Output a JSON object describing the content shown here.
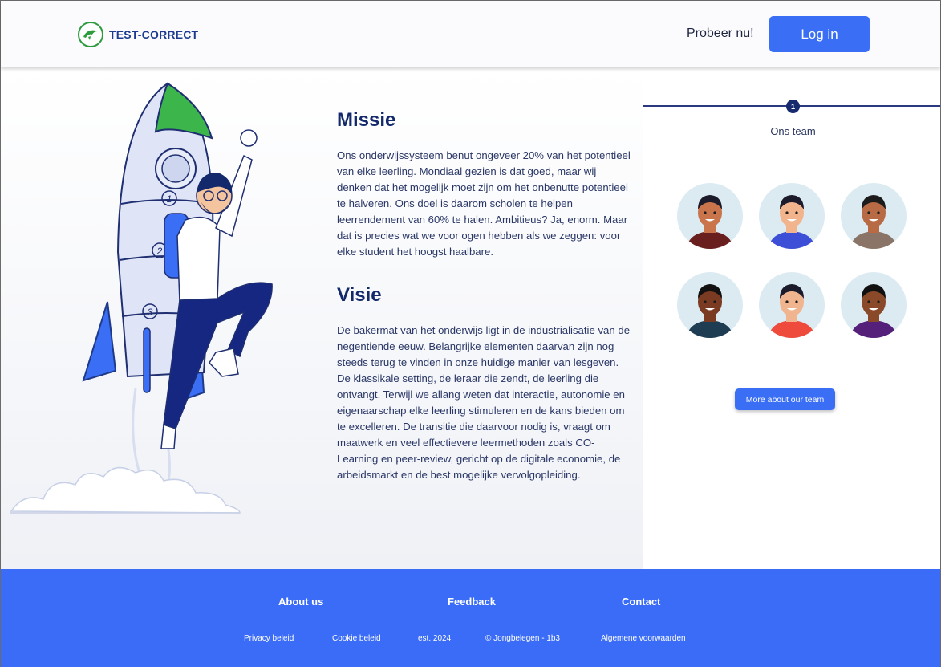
{
  "header": {
    "logo_text": "TEST-CORRECT",
    "try_label": "Probeer nu!",
    "login_label": "Log in"
  },
  "mission": {
    "title": "Missie",
    "text": "Ons onderwijssysteem benut ongeveer 20% van het potentieel van elke leerling. Mondiaal gezien is dat goed, maar wij denken dat het mogelijk moet zijn om het onbenutte potentieel te halveren. Ons doel is daarom scholen te helpen leerrendement van 60% te halen. Ambitieus? Ja, enorm. Maar dat is precies wat we voor ogen hebben als we zeggen: voor elke student het hoogst haalbare."
  },
  "vision": {
    "title": "Visie",
    "text": "De bakermat van het onderwijs ligt in de industrialisatie van de negentiende eeuw. Belangrijke elementen daarvan zijn nog steeds terug te vinden in onze huidige manier van lesgeven. De klassikale setting, de leraar die zendt, de leerling die ontvangt. Terwijl we allang weten dat interactie, autonomie en eigenaarschap elke leerling stimuleren en de kans bieden om te excelleren. De transitie die daarvoor nodig is, vraagt om maatwerk en veel effectievere leermethoden zoals CO-Learning en peer-review, gericht op de digitale economie, de arbeidsmarkt en de best mogelijke vervolgopleiding."
  },
  "rocket": {
    "labels": [
      "1",
      "2",
      "3"
    ]
  },
  "team": {
    "step": "1",
    "title": "Ons team",
    "button_label": "More about our team",
    "avatars": [
      {
        "skin": "#c9744a",
        "hair": "#1b1b2b",
        "shirt": "#6a1f1f"
      },
      {
        "skin": "#f2b48c",
        "hair": "#1b1b2b",
        "shirt": "#3d4fd6"
      },
      {
        "skin": "#b86a45",
        "hair": "#1b1b1b",
        "shirt": "#8a7468"
      },
      {
        "skin": "#7a3b22",
        "hair": "#111111",
        "shirt": "#1f3d52"
      },
      {
        "skin": "#f0b48e",
        "hair": "#1b1b2b",
        "shirt": "#ef4b3d"
      },
      {
        "skin": "#8a4a2a",
        "hair": "#111111",
        "shirt": "#55207a"
      }
    ]
  },
  "footer": {
    "headings": [
      "About us",
      "Feedback",
      "Contact"
    ],
    "links": [
      "Privacy beleid",
      "Cookie beleid",
      "est. 2024",
      "© Jongbelegen - 1b3",
      "Algemene voorwaarden"
    ]
  },
  "colors": {
    "primary": "#3a6ef5",
    "navy": "#13296b",
    "rocket_tip": "#3cb54a"
  }
}
